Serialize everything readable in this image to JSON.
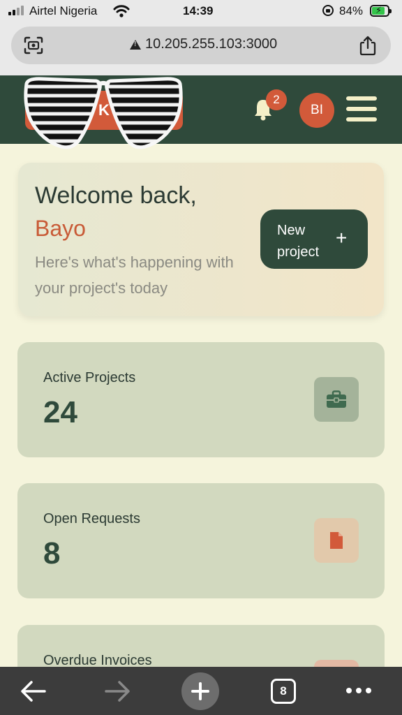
{
  "status_bar": {
    "carrier": "Airtel Nigeria",
    "time": "14:39",
    "battery_percent": "84%",
    "battery_level": 0.84,
    "icons": [
      "signal-icon",
      "wifi-icon",
      "orientation-lock-icon",
      "battery-charging-icon"
    ]
  },
  "browser": {
    "url": "10.205.255.103:3000",
    "icons": [
      "camera-scan-icon",
      "not-secure-warning-icon",
      "share-icon"
    ],
    "toolbar": {
      "tab_count": "8",
      "icons": [
        "back-arrow-icon",
        "forward-arrow-icon",
        "new-tab-plus-icon",
        "tabs-icon",
        "more-dots-icon"
      ]
    }
  },
  "header": {
    "logo_text": "K",
    "notification_count": "2",
    "avatar_initials": "BI",
    "colors": {
      "background": "#2f4a3b",
      "accent": "#d25a3a"
    }
  },
  "welcome": {
    "title": "Welcome back,",
    "name": "Bayo",
    "subtitle": "Here's what's happening with your project's today",
    "new_project_label": "New project",
    "new_project_icon": "+"
  },
  "stats": [
    {
      "label": "Active Projects",
      "value": "24",
      "icon": "briefcase-icon",
      "color": "#3f6a4f"
    },
    {
      "label": "Open Requests",
      "value": "8",
      "icon": "document-icon",
      "color": "#d25a3a"
    },
    {
      "label": "Overdue Invoices",
      "value": "",
      "icon": "invoice-icon",
      "color": "#d25a3a"
    }
  ]
}
